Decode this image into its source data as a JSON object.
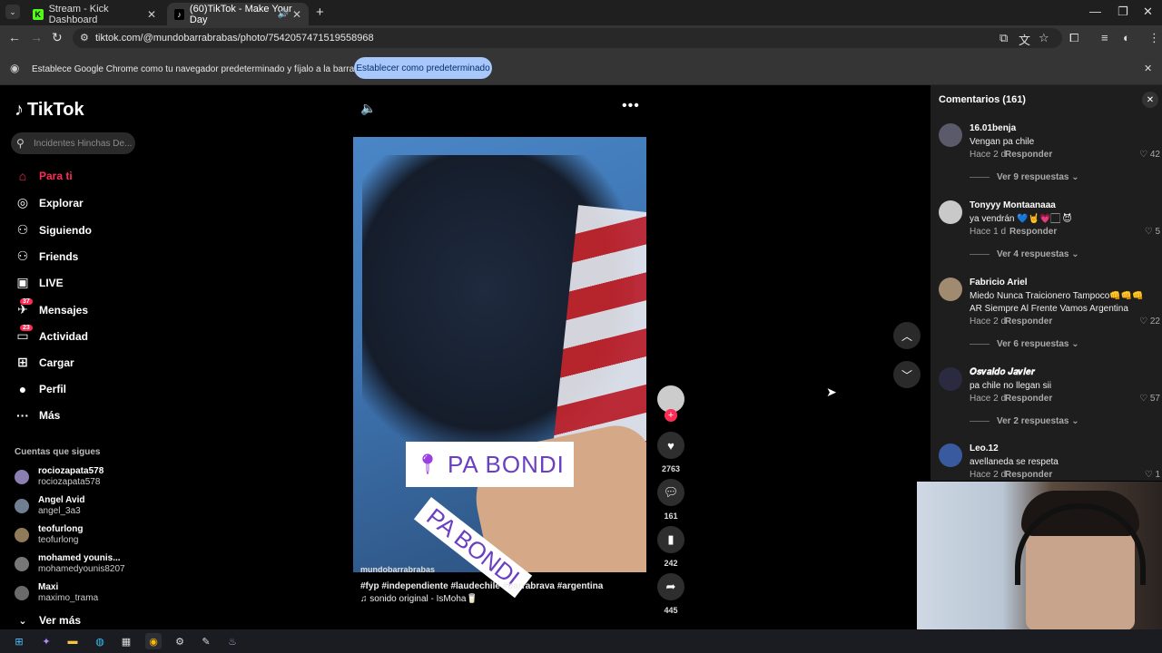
{
  "browser": {
    "tabs": [
      {
        "title": "Stream - Kick Dashboard",
        "favicon": "K",
        "color": "#53fc18"
      },
      {
        "title": "(60)TikTok - Make Your Day",
        "favicon": "♪",
        "color": "#000000"
      }
    ],
    "url": "tiktok.com/@mundobarrabrabas/photo/7542057471519558968",
    "infobar": {
      "text": "Establece Google Chrome como tu navegador predeterminado y fíjalo a la barra de tareas",
      "button": "Establecer como predeterminado"
    }
  },
  "tiktok": {
    "logo": "TikTok",
    "search_placeholder": "Incidentes Hinchas De...",
    "accent": "#fe2c55",
    "nav": [
      {
        "label": "Para ti",
        "icon": "home-icon",
        "glyph": "⌂",
        "active": true
      },
      {
        "label": "Explorar",
        "icon": "compass-icon",
        "glyph": "◎"
      },
      {
        "label": "Siguiendo",
        "icon": "following-icon",
        "glyph": "⚇"
      },
      {
        "label": "Friends",
        "icon": "friends-icon",
        "glyph": "⚇"
      },
      {
        "label": "LIVE",
        "icon": "live-icon",
        "glyph": "▣"
      },
      {
        "label": "Mensajes",
        "icon": "messages-icon",
        "glyph": "✈",
        "badge": "37"
      },
      {
        "label": "Actividad",
        "icon": "activity-icon",
        "glyph": "▭",
        "badge": "23"
      },
      {
        "label": "Cargar",
        "icon": "upload-icon",
        "glyph": "⊞"
      },
      {
        "label": "Perfil",
        "icon": "profile-icon",
        "glyph": "●"
      },
      {
        "label": "Más",
        "icon": "more-icon",
        "glyph": "···"
      }
    ],
    "following_title": "Cuentas que sigues",
    "following": [
      {
        "name": "rociozapata578",
        "handle": "rociozapata578"
      },
      {
        "name": "Angel Avid",
        "handle": "angel_3a3"
      },
      {
        "name": "teofurlong",
        "handle": "teofurlong"
      },
      {
        "name": "mohamed younis...",
        "handle": "mohamedyounis8207"
      },
      {
        "name": "Maxi",
        "handle": "maximo_trama"
      }
    ],
    "see_more": "Ver más",
    "video": {
      "sticker": "PA BONDI",
      "sticker2": "PA BONDI",
      "author": "mundobarrabrabas",
      "hashtags": "#fyp #independiente #laudechile #barrabrava #argentina",
      "sound": "♫ sonido original - IsMoha🥛"
    },
    "actions": {
      "likes": "2763",
      "comments": "161",
      "saves": "242",
      "shares": "445"
    },
    "comments_panel": {
      "title": "Comentarios (161)",
      "items": [
        {
          "user": "16.01benja",
          "text": "Vengan pa chile",
          "time": "Hace 2 d",
          "reply": "Responder",
          "likes": "42",
          "more": "Ver 9 respuestas ⌄"
        },
        {
          "user": "Tonyyy Montaanaaa",
          "text": "ya vendrán 💙🤘💗🏻 😈",
          "time": "Hace 1 d",
          "reply": "Responder",
          "likes": "5",
          "more": "Ver 4 respuestas ⌄"
        },
        {
          "user": "Fabricio Ariel",
          "text": "Miedo Nunca Traicionero Tampoco👊👊👊AR Siempre Al Frente Vamos Argentina",
          "time": "Hace 2 d",
          "reply": "Responder",
          "likes": "22",
          "more": "Ver 6 respuestas ⌄"
        },
        {
          "user": "𝑶𝒔𝒗𝒂𝒍𝒅𝒐 𝑱𝒂𝒗𝒊𝒆𝒓",
          "text": "pa chile no llegan sii",
          "time": "Hace 2 d",
          "reply": "Responder",
          "likes": "57",
          "more": "Ver 2 respuestas ⌄"
        },
        {
          "user": "Leo.12",
          "text": "avellaneda se respeta",
          "time": "Hace 2 d",
          "reply": "Responder",
          "likes": "1",
          "more": ""
        }
      ]
    }
  }
}
